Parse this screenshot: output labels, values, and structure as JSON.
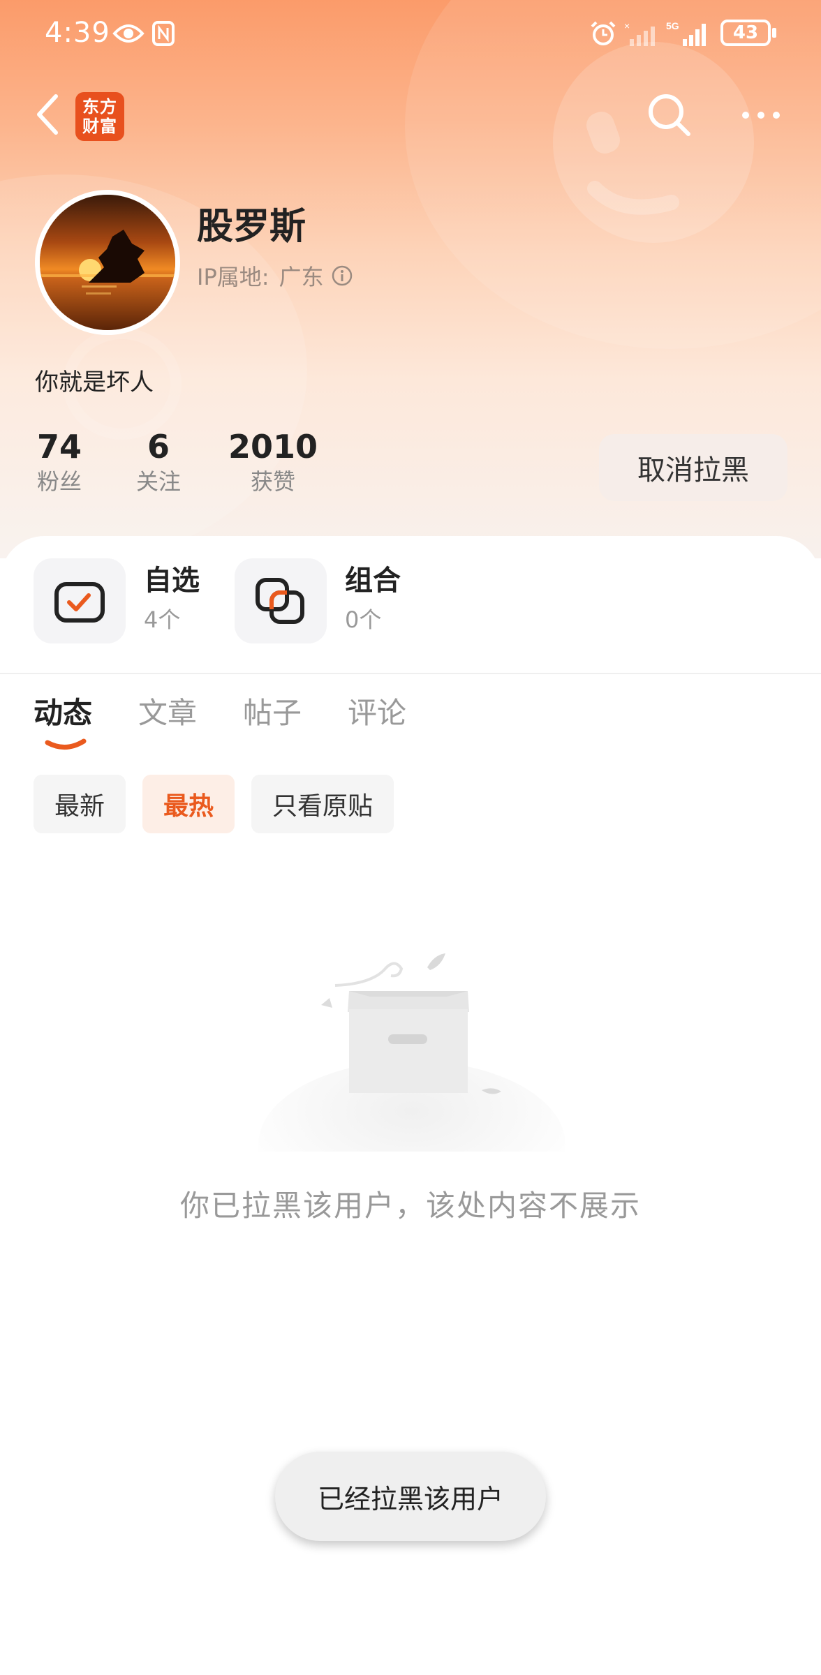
{
  "status_bar": {
    "time": "4:39",
    "network": "5G",
    "battery": "43",
    "icons": [
      "eye-icon",
      "nfc-icon",
      "alarm-icon",
      "signal-icon",
      "battery-icon"
    ]
  },
  "nav": {
    "logo_line1": "东方",
    "logo_line2": "财富",
    "icons": [
      "back-arrow-icon",
      "search-icon",
      "more-icon"
    ]
  },
  "profile": {
    "name": "股罗斯",
    "ip_label": "IP属地:",
    "ip_value": "广东",
    "bio": "你就是坏人"
  },
  "stats": [
    {
      "value": "74",
      "label": "粉丝"
    },
    {
      "value": "6",
      "label": "关注"
    },
    {
      "value": "2010",
      "label": "获赞"
    }
  ],
  "unblock_button": "取消拉黑",
  "features": [
    {
      "title": "自选",
      "count": "4个",
      "icon": "watchlist-icon"
    },
    {
      "title": "组合",
      "count": "0个",
      "icon": "portfolio-icon"
    }
  ],
  "tabs": [
    {
      "label": "动态",
      "active": true
    },
    {
      "label": "文章",
      "active": false
    },
    {
      "label": "帖子",
      "active": false
    },
    {
      "label": "评论",
      "active": false
    }
  ],
  "filters": [
    {
      "label": "最新",
      "active": false
    },
    {
      "label": "最热",
      "active": true
    },
    {
      "label": "只看原贴",
      "active": false
    }
  ],
  "empty_message": "你已拉黑该用户，该处内容不展示",
  "toast": "已经拉黑该用户",
  "colors": {
    "accent": "#ea5a1e",
    "logo": "#e8501e",
    "hero_top": "#fb9b6a"
  }
}
